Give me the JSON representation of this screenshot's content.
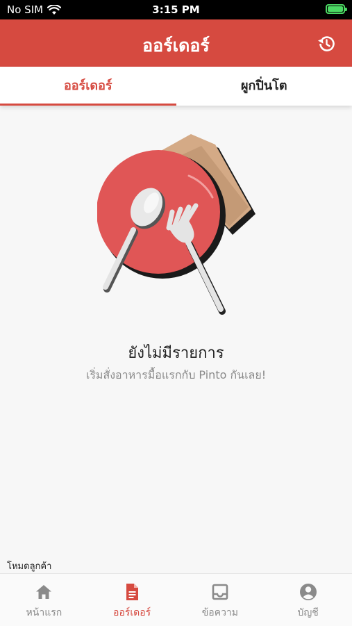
{
  "status": {
    "carrier": "No SIM",
    "time": "3:15 PM"
  },
  "header": {
    "title": "ออร์เดอร์",
    "history_icon": "history-icon"
  },
  "tabs": [
    {
      "label": "ออร์เดอร์",
      "active": true
    },
    {
      "label": "ผูกปิ่นโต",
      "active": false
    }
  ],
  "empty_state": {
    "title": "ยังไม่มีรายการ",
    "subtitle": "เริ่มสั่งอาหารมื้อแรกกับ Pinto กันเลย!",
    "illustration": "plate-spoon-fork-illustration"
  },
  "mode_label": "โหมดลูกค้า",
  "bottom_nav": [
    {
      "label": "หน้าแรก",
      "icon": "home-icon",
      "active": false
    },
    {
      "label": "ออร์เดอร์",
      "icon": "document-icon",
      "active": true
    },
    {
      "label": "ข้อความ",
      "icon": "inbox-icon",
      "active": false
    },
    {
      "label": "บัญชี",
      "icon": "account-icon",
      "active": false
    }
  ],
  "colors": {
    "brand": "#d64a40",
    "inactive": "#8a8a8a",
    "background": "#f7f7f7"
  }
}
